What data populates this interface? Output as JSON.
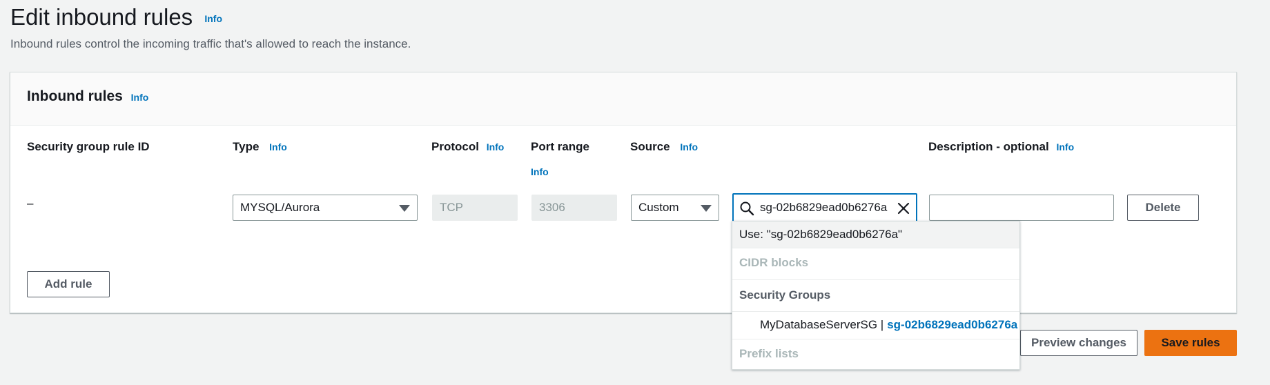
{
  "page": {
    "title": "Edit inbound rules",
    "title_info": "Info",
    "description": "Inbound rules control the incoming traffic that's allowed to reach the instance."
  },
  "panel": {
    "title": "Inbound rules",
    "title_info": "Info"
  },
  "columns": {
    "rule_id": "Security group rule ID",
    "type": "Type",
    "type_info": "Info",
    "protocol": "Protocol",
    "protocol_info": "Info",
    "port_range": "Port range",
    "port_range_info": "Info",
    "source": "Source",
    "source_info": "Info",
    "description": "Description - optional",
    "description_info": "Info"
  },
  "rule": {
    "id": "–",
    "type": "MYSQL/Aurora",
    "protocol": "TCP",
    "port_range": "3306",
    "source": "Custom",
    "source_search": "sg-02b6829ead0b6276a",
    "description": "",
    "delete_label": "Delete"
  },
  "dropdown": {
    "use_option": "Use: \"sg-02b6829ead0b6276a\"",
    "cidr_header": "CIDR blocks",
    "sg_header": "Security Groups",
    "sg_item_name": "MyDatabaseServerSG |",
    "sg_item_id": "sg-02b6829ead0b6276a",
    "prefix_header": "Prefix lists"
  },
  "actions": {
    "add_rule": "Add rule",
    "preview": "Preview changes",
    "save": "Save rules"
  },
  "colors": {
    "accent": "#0073bb",
    "primary_button": "#ec7211",
    "background": "#f2f3f3"
  }
}
